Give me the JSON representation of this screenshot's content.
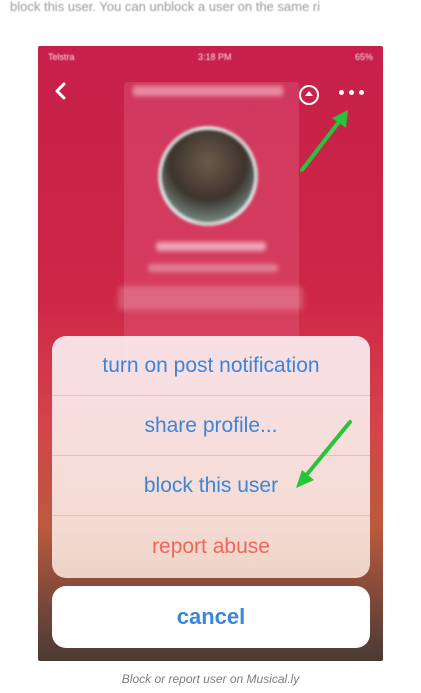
{
  "page": {
    "top_text": "block this user.  You can unblock a user on the same ri",
    "caption": "Block or report user on Musical.ly"
  },
  "status_bar": {
    "carrier": "Telstra",
    "time": "3:18 PM",
    "battery": "65%"
  },
  "action_sheet": {
    "items": [
      {
        "label": "turn on post notification",
        "style": "default"
      },
      {
        "label": "share profile...",
        "style": "default"
      },
      {
        "label": "block this user",
        "style": "default"
      },
      {
        "label": "report abuse",
        "style": "destructive"
      }
    ],
    "cancel_label": "cancel"
  },
  "icons": {
    "back": "chevron-left-icon",
    "gift": "gift-icon",
    "more": "more-horizontal-icon",
    "annotation_arrow": "arrow-icon"
  },
  "colors": {
    "action_blue": "#3a86d8",
    "destructive_red": "#f0665c",
    "background_red": "#c7204a",
    "annotation_green": "#27c43a"
  }
}
